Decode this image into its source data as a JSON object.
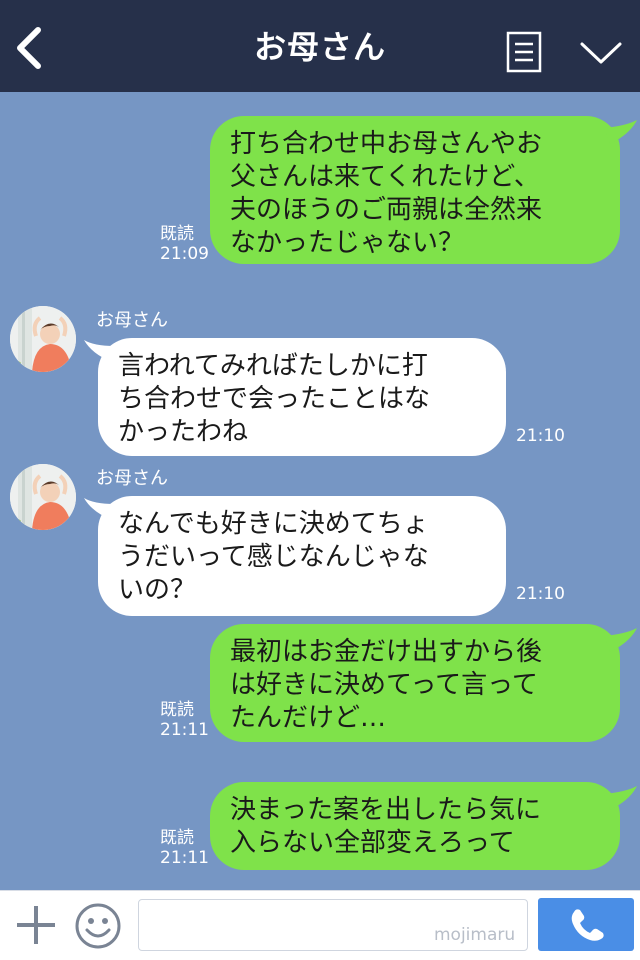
{
  "header": {
    "title": "お母さん",
    "back_icon": "chevron-left-icon",
    "menu_icon": "list-menu-icon",
    "collapse_icon": "chevron-down-icon",
    "background_color": "#26304a"
  },
  "chat": {
    "background_color": "#7696c4",
    "sent_bubble_color": "#7fe24a",
    "received_bubble_color": "#ffffff",
    "messages": [
      {
        "direction": "sent",
        "lines": [
          "打ち合わせ中お母さんやお",
          "父さんは来てくれたけど、",
          "夫のほうのご両親は全然来",
          "なかったじゃない？"
        ],
        "read_label": "既読",
        "time": "21:09"
      },
      {
        "direction": "received",
        "sender": "お母さん",
        "lines": [
          "言われてみればたしかに打",
          "ち合わせで会ったことはな",
          "かったわね"
        ],
        "time": "21:10"
      },
      {
        "direction": "received",
        "sender": "お母さん",
        "lines": [
          "なんでも好きに決めてちょ",
          "うだいって感じなんじゃな",
          "いの？"
        ],
        "time": "21:10"
      },
      {
        "direction": "sent",
        "lines": [
          "最初はお金だけ出すから後",
          "は好きに決めてって言って",
          "たんだけど…"
        ],
        "read_label": "既読",
        "time": "21:11"
      },
      {
        "direction": "sent",
        "lines": [
          "決まった案を出したら気に",
          "入らない全部変えろって"
        ],
        "read_label": "既読",
        "time": "21:11"
      }
    ]
  },
  "composer": {
    "plus_icon": "plus-icon",
    "sticker_icon": "smiley-icon",
    "input_value": "",
    "watermark": "mojimaru",
    "call_icon": "phone-icon",
    "call_button_color": "#4a8ee6"
  }
}
